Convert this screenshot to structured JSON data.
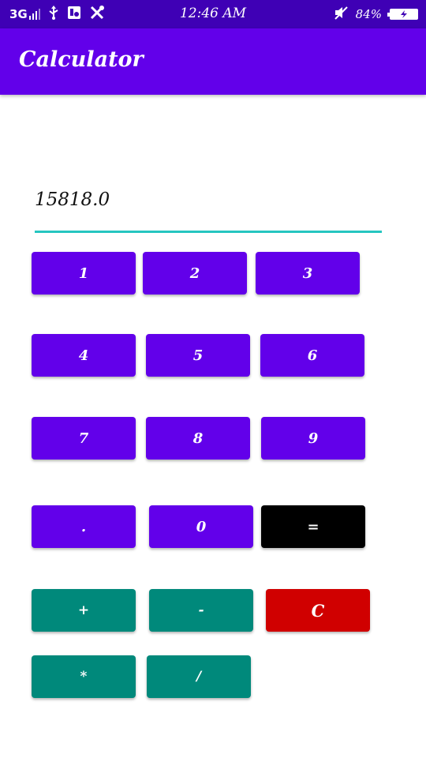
{
  "status_bar": {
    "network": "3G",
    "time": "12:46 AM",
    "battery": "84%"
  },
  "app_bar": {
    "title": "Calculator"
  },
  "display": {
    "value": "15818.0"
  },
  "keypad": {
    "one": "1",
    "two": "2",
    "three": "3",
    "four": "4",
    "five": "5",
    "six": "6",
    "seven": "7",
    "eight": "8",
    "nine": "9",
    "dot": ".",
    "zero": "0",
    "equals": "=",
    "plus": "+",
    "minus": "-",
    "clear": "C",
    "multiply": "*",
    "divide": "/"
  },
  "colors": {
    "status_bar": "#3f00b5",
    "app_bar": "#6200ea",
    "digit_button": "#6200ea",
    "operator_button": "#00897b",
    "equals_button": "#000000",
    "clear_button": "#d00000",
    "display_underline": "#26c6c0"
  },
  "icons": [
    "signal-icon",
    "usb-icon",
    "debug-icon",
    "tools-icon",
    "mute-icon",
    "battery-icon",
    "charging-icon"
  ]
}
